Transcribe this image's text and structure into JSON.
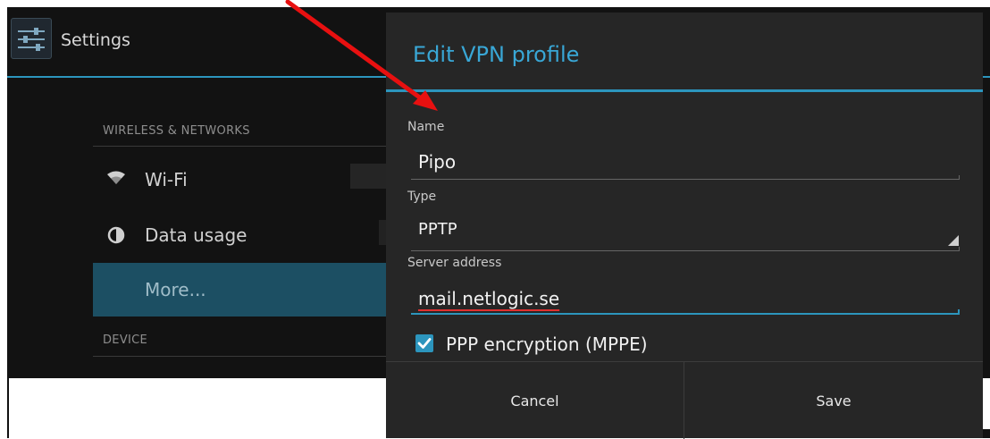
{
  "settings": {
    "title": "Settings",
    "sections": {
      "wireless": "WIRELESS & NETWORKS",
      "device": "DEVICE"
    },
    "items": [
      {
        "label": "Wi-Fi",
        "icon": "wifi-icon"
      },
      {
        "label": "Data usage",
        "icon": "data-usage-icon"
      },
      {
        "label": "More...",
        "selected": true
      }
    ]
  },
  "dialog": {
    "title": "Edit VPN profile",
    "name": {
      "label": "Name",
      "value": "Pipo"
    },
    "type": {
      "label": "Type",
      "value": "PPTP"
    },
    "server": {
      "label": "Server address",
      "value": "mail.netlogic.se"
    },
    "encryption": {
      "label": "PPP encryption (MPPE)",
      "checked": true
    },
    "buttons": {
      "cancel": "Cancel",
      "save": "Save"
    }
  },
  "colors": {
    "accent": "#2c95bd",
    "title": "#39a7d6",
    "annotation_arrow": "#e81010",
    "background": "#121212",
    "dialog": "#262626"
  }
}
